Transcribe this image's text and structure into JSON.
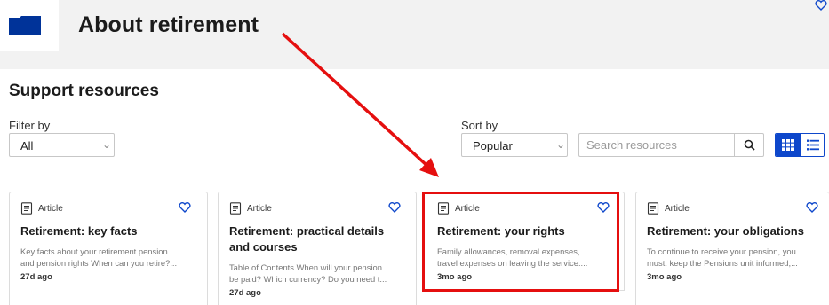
{
  "header": {
    "title": "About retirement"
  },
  "section": {
    "title": "Support resources"
  },
  "filter": {
    "label": "Filter by",
    "value": "All"
  },
  "sort": {
    "label": "Sort by",
    "value": "Popular"
  },
  "search": {
    "placeholder": "Search resources"
  },
  "cards": [
    {
      "type": "Article",
      "title": "Retirement: key facts",
      "desc1": "Key facts about your retirement pension",
      "desc2": "and pension rights When can you retire?...",
      "date": "27d ago"
    },
    {
      "type": "Article",
      "title": "Retirement: practical details and courses",
      "desc1": "Table of Contents When will your pension",
      "desc2": "be paid? Which currency? Do you need t...",
      "date": "27d ago"
    },
    {
      "type": "Article",
      "title": "Retirement: your rights",
      "desc1": "Family allowances, removal expenses,",
      "desc2": "travel expenses on leaving the service:...",
      "date": "3mo ago"
    },
    {
      "type": "Article",
      "title": "Retirement: your obligations",
      "desc1": "To continue to receive your pension, you",
      "desc2": "must: keep the Pensions unit informed,...",
      "date": "3mo ago"
    }
  ],
  "colors": {
    "accent": "#0e47cb",
    "highlight": "#e50f0f",
    "logo": "#003399"
  },
  "icons": [
    "folder-icon",
    "heart-icon",
    "chevron-down-icon",
    "search-icon",
    "grid-view-icon",
    "list-view-icon",
    "article-icon"
  ]
}
